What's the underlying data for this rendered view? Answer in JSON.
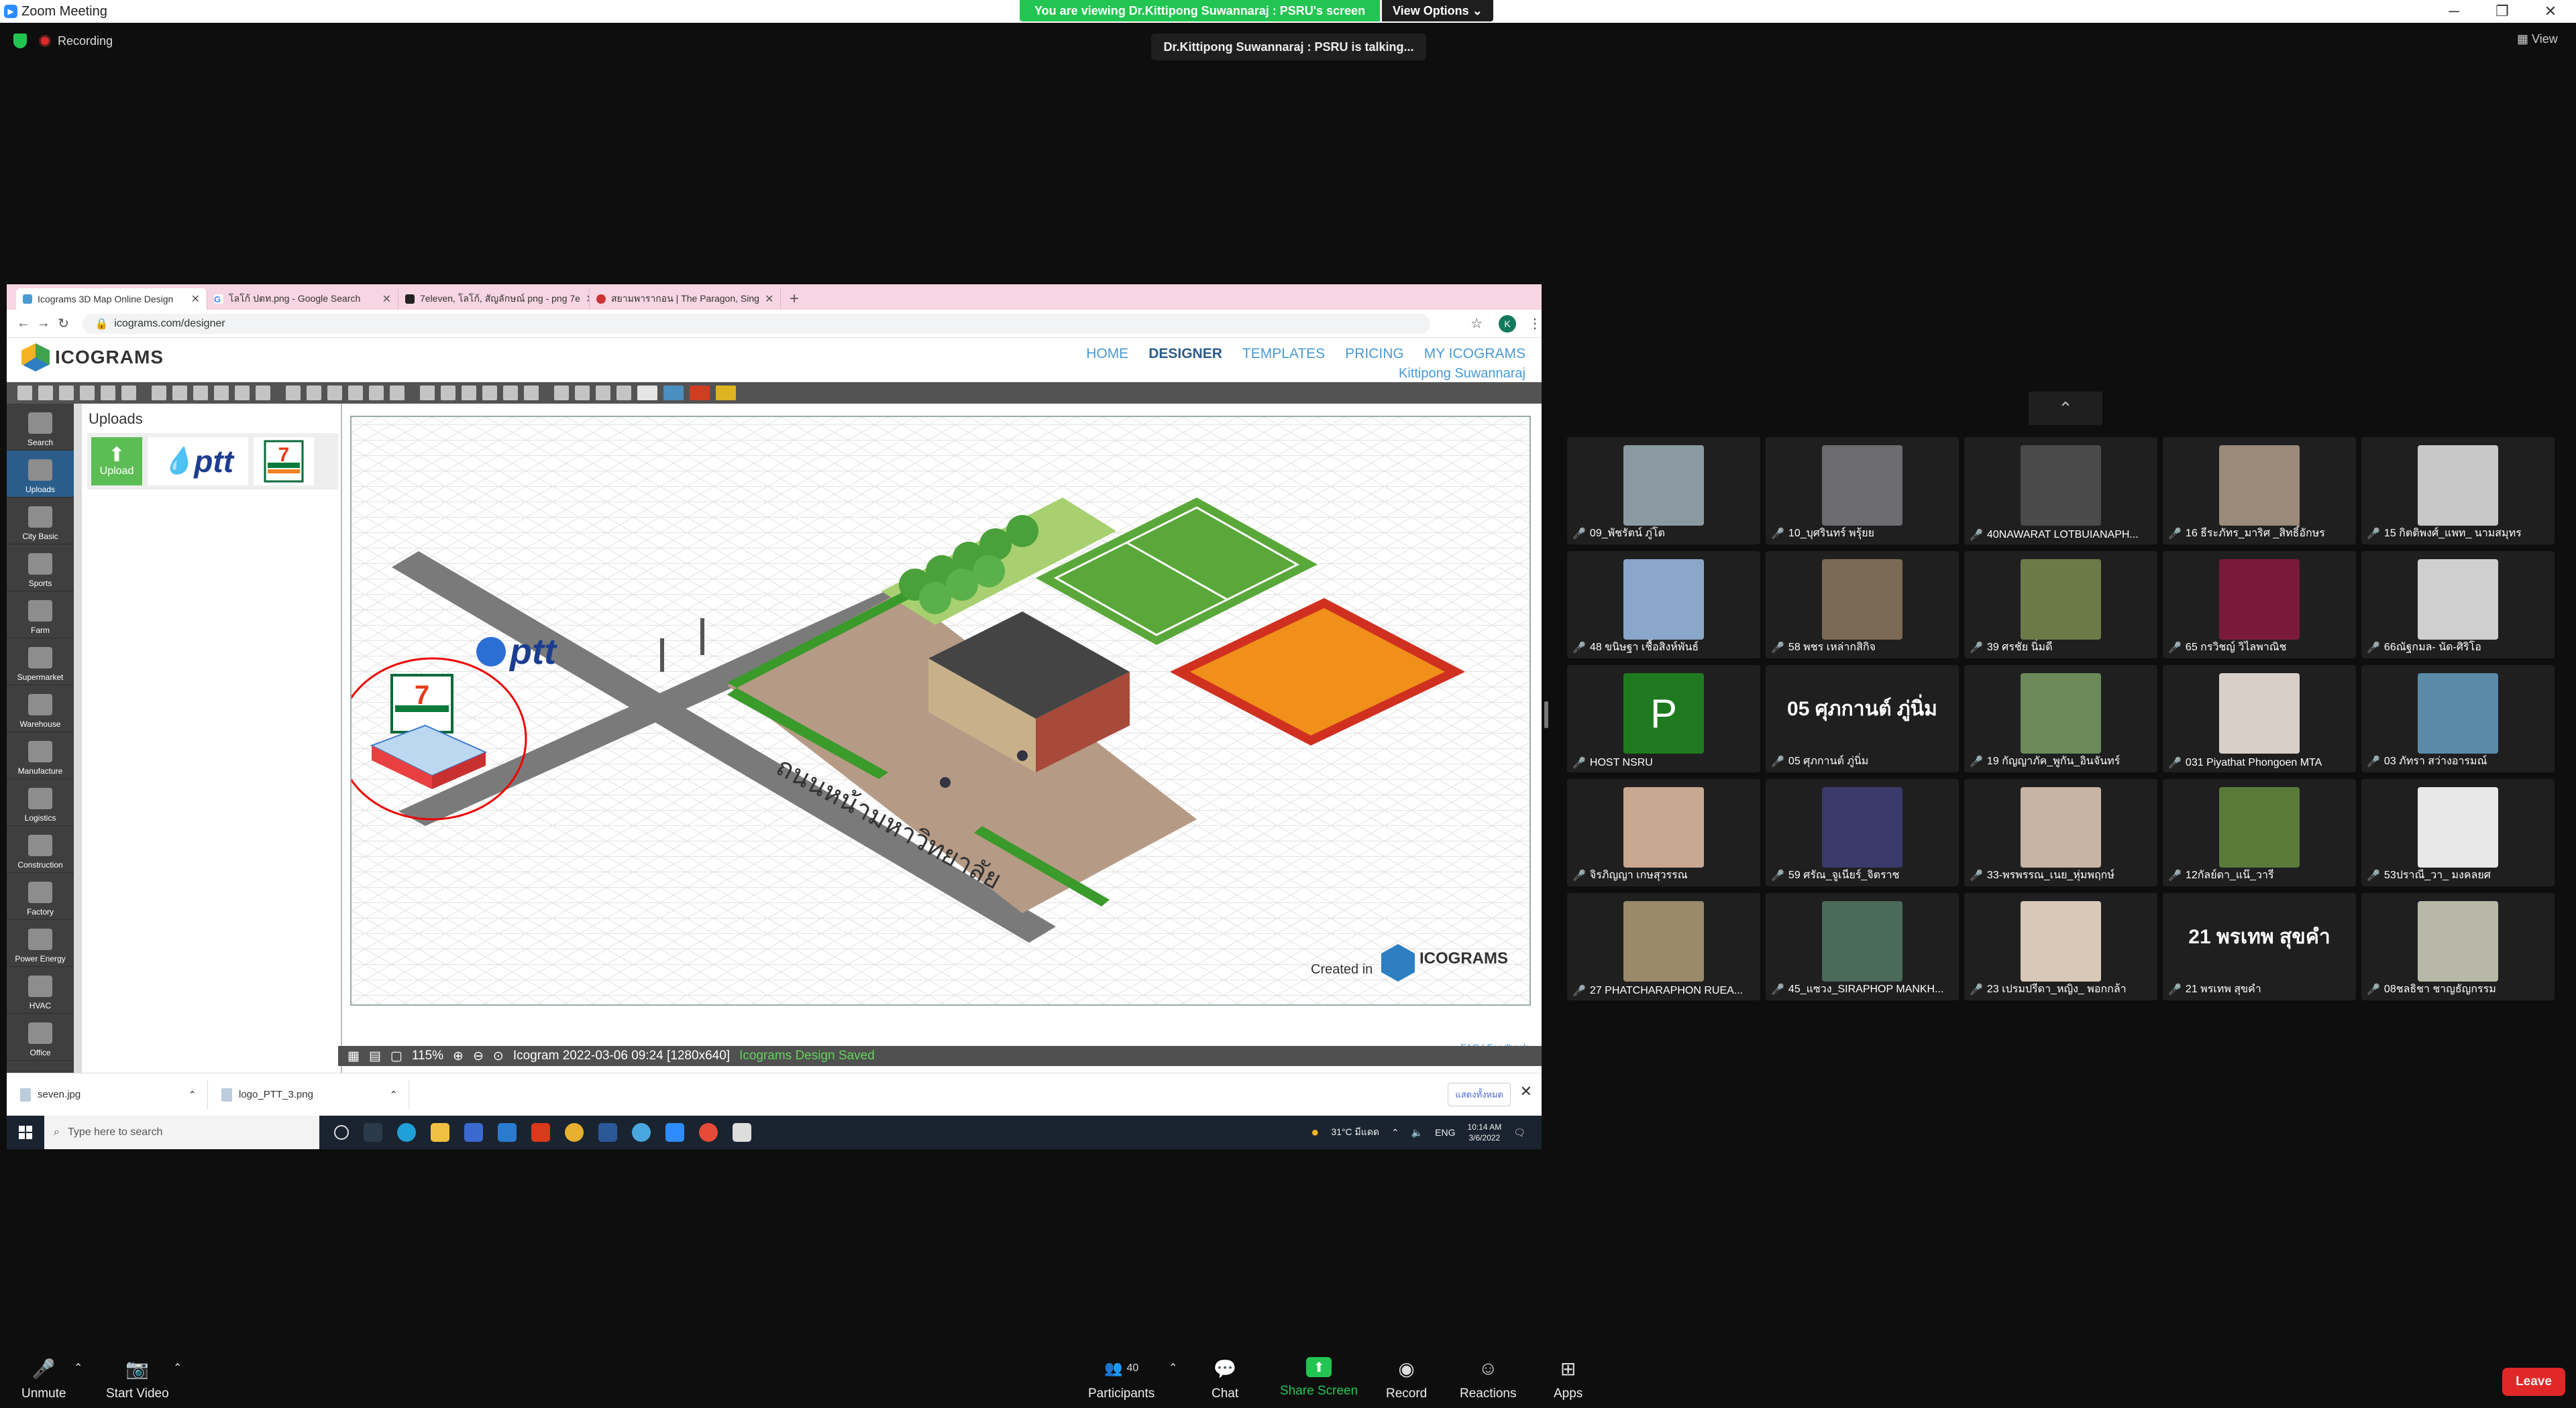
{
  "zoom": {
    "window_title": "Zoom Meeting",
    "viewing_banner": "You are viewing Dr.Kittipong Suwannaraj : PSRU's screen",
    "view_options": "View Options",
    "recording": "Recording",
    "talking": "Dr.Kittipong Suwannaraj : PSRU is talking...",
    "view_button": "View"
  },
  "browser": {
    "tabs": [
      {
        "label": "Icograms 3D Map Online Design"
      },
      {
        "label": "โลโก้ ปตท.png - Google Search"
      },
      {
        "label": "7eleven, โลโก้, สัญลักษณ์ png - png 7e"
      },
      {
        "label": "สยามพารากอน | The Paragon, Sing"
      }
    ],
    "url": "icograms.com/designer",
    "profile_initial": "K"
  },
  "icograms": {
    "logo": "ICOGRAMS",
    "menu": [
      "HOME",
      "DESIGNER",
      "TEMPLATES",
      "PRICING",
      "MY ICOGRAMS"
    ],
    "user": "Kittipong Suwannaraj",
    "sidebar": [
      "Search",
      "Uploads",
      "City Basic",
      "Sports",
      "Farm",
      "Supermarket",
      "Warehouse",
      "Manufacture",
      "Logistics",
      "Construction",
      "Factory",
      "Power Energy",
      "HVAC",
      "Office"
    ],
    "uploads_title": "Uploads",
    "upload_button": "Upload",
    "ptt_logo": "ptt",
    "seven_text": "ELEVEN",
    "road_label": "ถนนหน้ามหาวิทยาลัย",
    "created_in": "Created in",
    "status": {
      "zoom": "115%",
      "doc_name": "Icogram 2022-03-06 09:24 [1280x640]",
      "saved": "Icograms Design Saved",
      "faq": "FAQ | Feedback"
    }
  },
  "downloads": [
    {
      "file": "seven.jpg"
    },
    {
      "file": "logo_PTT_3.png"
    }
  ],
  "downloads_show_all": "แสดงทั้งหมด",
  "taskbar": {
    "search": "Type here to search",
    "weather": "31°C มีแดด",
    "lang": "ENG",
    "time": "10:14 AM",
    "date": "3/6/2022"
  },
  "participants": [
    {
      "name": "09_พัชรัตน์ ภู่โต",
      "kind": "photo",
      "color": "#8a9aa0"
    },
    {
      "name": "10_บุศรินทร์ พรุ้ยย",
      "kind": "photo",
      "color": "#6b6b70"
    },
    {
      "name": "40NAWARAT LOTBUIANAPH...",
      "kind": "photo",
      "color": "#4a4a4a"
    },
    {
      "name": "16 ธีระภัทร_มาริศ _สิทธิ์อักษร",
      "kind": "photo",
      "color": "#9a8a7a"
    },
    {
      "name": "15 กิตติพงศ์_แพท_ นามสมุทร",
      "kind": "photo",
      "color": "#c8c8c8"
    },
    {
      "name": "48 ขนิษฐา เชื้อสิงห์พันธ์",
      "kind": "photo",
      "color": "#8aa6c8"
    },
    {
      "name": "58 พชร เหล่ากสิกิจ",
      "kind": "photo",
      "color": "#7a6a55"
    },
    {
      "name": "39 ศรชัย นิ่มดี",
      "kind": "photo",
      "color": "#6c7a4a"
    },
    {
      "name": "65 กรวิชญ์ วิไลพาณิช",
      "kind": "photo",
      "color": "#7a1a3a"
    },
    {
      "name": "66ณัฐกมล- นัด-ศิริโอ",
      "kind": "photo",
      "color": "#cfcfcf"
    },
    {
      "name": "HOST NSRU",
      "kind": "letter",
      "letter": "P"
    },
    {
      "name": "05 ศุภกานต์ ภู่นิ่ม",
      "kind": "text",
      "big": "05 ศุภกานต์ ภู่นิ่ม"
    },
    {
      "name": "19 กัญญาภัค_พูกัน_อินจันทร์",
      "kind": "photo",
      "color": "#6a8a5a"
    },
    {
      "name": "031 Piyathat Phongoen MTA",
      "kind": "photo",
      "color": "#d8d0c8"
    },
    {
      "name": "03 ภัทรา สว่างอารมณ์",
      "kind": "photo",
      "color": "#5a8aa8"
    },
    {
      "name": "จิรภิญญา เกษสุวรรณ",
      "kind": "photo",
      "color": "#c8a890"
    },
    {
      "name": "59 ศรัณ_จูเนียร์_จิตราช",
      "kind": "photo",
      "color": "#3a3a6a"
    },
    {
      "name": "33-พรพรรณ_เนย_หุ่มพฤกษ์",
      "kind": "photo",
      "color": "#c8b4a4"
    },
    {
      "name": "12กัลย์ดา_แน๊_วารี",
      "kind": "photo",
      "color": "#5a7a3a"
    },
    {
      "name": "53ปราณี_วา_ มงคลยศ",
      "kind": "photo",
      "color": "#e8e8e8"
    },
    {
      "name": "27 PHATCHARAPHON RUEA...",
      "kind": "photo",
      "color": "#9a8a6a"
    },
    {
      "name": "45_แซวง_SIRAPHOP MANKH...",
      "kind": "photo",
      "color": "#4a6a5a"
    },
    {
      "name": "23 เปรมปรีดา_หญิง_ พอกกล้า",
      "kind": "photo",
      "color": "#d8c8b8"
    },
    {
      "name": "21 พรเทพ สุขคำ",
      "kind": "text",
      "big": "21 พรเทพ สุขคำ"
    },
    {
      "name": "08ชลธิชา ชาญธัญกรรม",
      "kind": "photo",
      "color": "#b8b8a8"
    }
  ],
  "controls": {
    "unmute": "Unmute",
    "start_video": "Start Video",
    "participants": "Participants",
    "participant_count": "40",
    "chat": "Chat",
    "share_screen": "Share Screen",
    "record": "Record",
    "reactions": "Reactions",
    "apps": "Apps",
    "leave": "Leave"
  }
}
